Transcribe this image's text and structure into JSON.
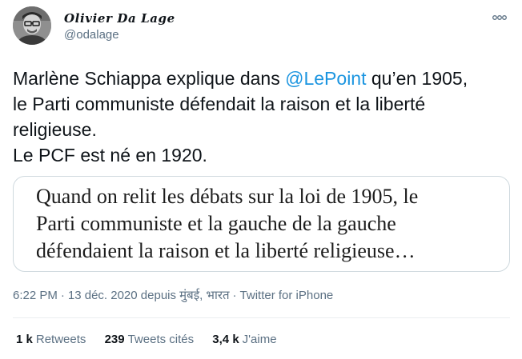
{
  "author": {
    "display_name": "Olivier Da Lage",
    "handle": "@odalage"
  },
  "tweet": {
    "line1_before": "Marlène Schiappa explique dans ",
    "mention": "@LePoint",
    "line1_after": " qu’en 1905,",
    "line2": "le Parti communiste défendait la raison et la liberté",
    "line3": "religieuse.",
    "line4": "Le PCF est né en 1920."
  },
  "media": {
    "lines": [
      "Quand on relit les débats sur la loi de 1905, le",
      "Parti communiste et la gauche de la gauche",
      "défendaient la raison et la liberté religieuse…"
    ]
  },
  "meta": {
    "time": "6:22 PM",
    "separator": "·",
    "date": "13 déc. 2020",
    "location": "depuis मुंबई, भारत",
    "source": "Twitter for iPhone"
  },
  "stats": [
    {
      "count": "1 k",
      "label": "Retweets"
    },
    {
      "count": "239",
      "label": "Tweets cités"
    },
    {
      "count": "3,4 k",
      "label": "J'aime"
    }
  ],
  "icons": {
    "more": "more-horizontal-icon"
  },
  "colors": {
    "link": "#1b95e0",
    "secondary_text": "#5b7083",
    "primary_text": "#0f1419",
    "border": "#cfd9de"
  }
}
